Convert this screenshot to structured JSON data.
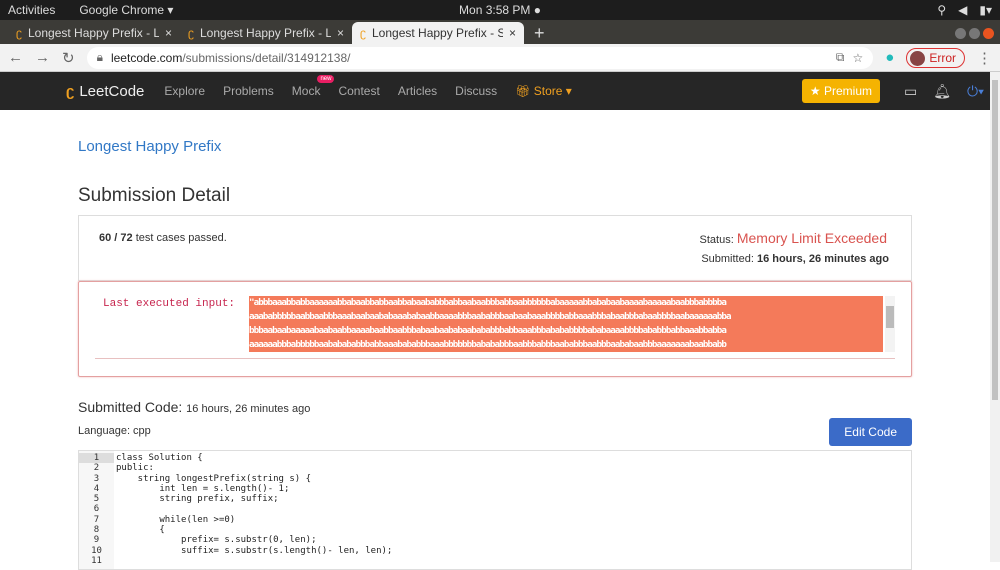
{
  "os": {
    "activities": "Activities",
    "app": "Google Chrome ▾",
    "clock": "Mon  3:58 PM ●"
  },
  "tabs": [
    {
      "title": "Longest Happy Prefix - Le"
    },
    {
      "title": "Longest Happy Prefix - Le"
    },
    {
      "title": "Longest Happy Prefix - Su"
    }
  ],
  "address": {
    "domain": "leetcode.com",
    "path": "/submissions/detail/314912138/",
    "profile_status": "Error"
  },
  "nav": {
    "logo": "LeetCode",
    "items": [
      "Explore",
      "Problems",
      "Mock",
      "Contest",
      "Articles",
      "Discuss"
    ],
    "mock_badge": "new",
    "store": "Store ▾",
    "premium": "★ Premium"
  },
  "page": {
    "problem_link": "Longest Happy Prefix",
    "heading": "Submission Detail",
    "passed_count": "60 / 72",
    "passed_text": " test cases passed.",
    "status_label": "Status: ",
    "status_value": "Memory Limit Exceeded",
    "submitted_label": "Submitted: ",
    "submitted_value": "16 hours, 26 minutes ago",
    "last_input_label": "Last executed input:",
    "last_input_lines": [
      "\"abbbaaabbabbaaaaaabbabaabbabbaabbabaababbbabbaabaabbbabbaabbbbbbabaaaaabbababaabaaaabaaaaabaabbbabbbba",
      "aaababbbbbaabbaabbbaaabaabaababaaababaabbaaaabbbaababbbaabaabaaabbbbabbaaabbbabaabbbabaabbbbaabaaaaaabba",
      "bbbaabaabaaaaabaabaabbaaaabaabbaabbbabaabaababaabababbbabbaaabbbabababbbbababaaaabbbbababbbabbaaabbabba",
      "aaaaaabbbabbbbbaababababbbabbaaabababbbaaabbbbbbbabababbbaabbbabbbaababbbaabbbaababaabbbaaaaaaabaabbabb"
    ],
    "submitted_code_label": "Submitted Code: ",
    "submitted_code_time": "16 hours, 26 minutes ago",
    "language": "Language: cpp",
    "edit_code": "Edit Code",
    "code_lines": [
      "class Solution {",
      "public:",
      "    string longestPrefix(string s) {",
      "        int len = s.length()- 1;",
      "        string prefix, suffix;",
      "",
      "        while(len >=0)",
      "        {",
      "            prefix= s.substr(0, len);",
      "            suffix= s.substr(s.length()- len, len);",
      ""
    ]
  }
}
